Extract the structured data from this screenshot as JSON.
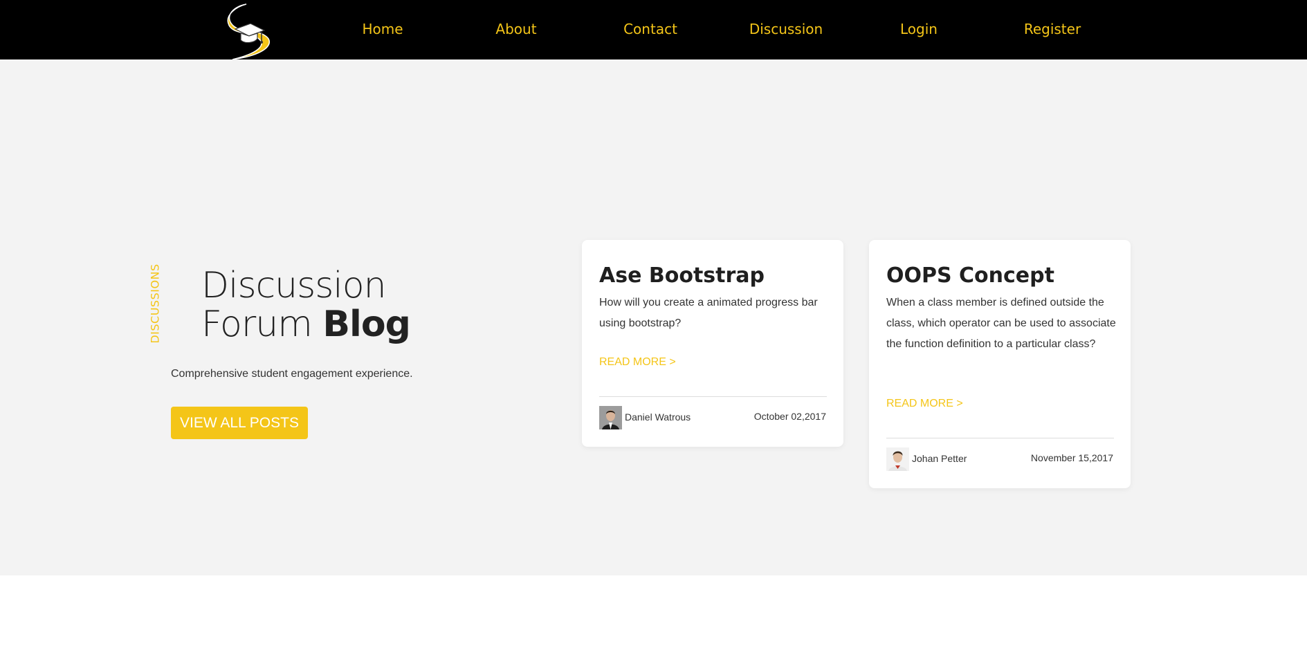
{
  "nav": {
    "logo_icon": "graduation-cap-swoosh-logo",
    "items": [
      {
        "label": "Home"
      },
      {
        "label": "About"
      },
      {
        "label": "Contact"
      },
      {
        "label": "Discussion"
      },
      {
        "label": "Login"
      },
      {
        "label": "Register"
      }
    ]
  },
  "hero": {
    "side_label": "DISCUSSIONS",
    "title_line1": "Discussion",
    "title_line2_regular": "Forum",
    "title_line2_bold": "Blog",
    "description": "Comprehensive student engagement experience.",
    "cta_label": "VIEW ALL POSTS"
  },
  "posts": [
    {
      "title": "Ase Bootstrap",
      "body": "How will you create a animated progress bar using bootstrap?",
      "read_more": "READ MORE >",
      "author": "Daniel Watrous",
      "date": "October 02,2017"
    },
    {
      "title": "OOPS Concept",
      "body": "When a class member is defined outside the class, which operator can be used to associate the function definition to a particular class?",
      "read_more": "READ MORE >",
      "author": "Johan Petter",
      "date": "November 15,2017"
    }
  ],
  "colors": {
    "accent": "#f4c518",
    "header_bg": "#000000",
    "hero_bg": "#f3f3f3",
    "card_bg": "#ffffff"
  }
}
